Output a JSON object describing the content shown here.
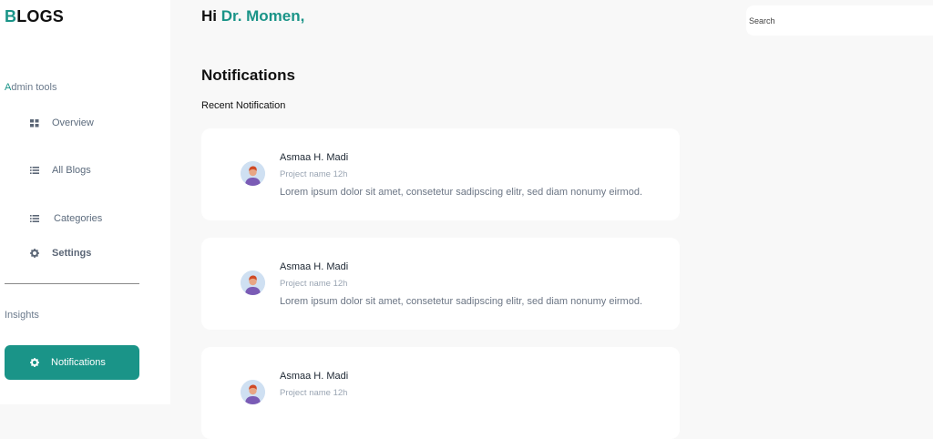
{
  "logo": {
    "first_letter": "B",
    "rest": "LOGS"
  },
  "sidebar": {
    "admin_label_first": "A",
    "admin_label_rest": "dmin tools",
    "items": [
      {
        "label": "Overview",
        "icon": "grid-icon"
      },
      {
        "label": "All Blogs",
        "icon": "list-icon"
      },
      {
        "label": "Categories",
        "icon": "list-icon"
      },
      {
        "label": "Settings",
        "icon": "gear-icon"
      }
    ],
    "insights_label": "Insights",
    "active_item": {
      "label": "Notifications",
      "icon": "gear-icon"
    }
  },
  "header": {
    "greeting": "Hi",
    "user_name": "Dr. Momen,",
    "search_placeholder": "Search"
  },
  "main": {
    "title": "Notifications",
    "subtitle": "Recent Notification",
    "notifications": [
      {
        "author": "Asmaa H. Madi",
        "meta": "Project name 12h",
        "body": "Lorem ipsum dolor sit amet, consetetur sadipscing elitr, sed diam nonumy eirmod."
      },
      {
        "author": "Asmaa H. Madi",
        "meta": "Project name 12h",
        "body": "Lorem ipsum dolor sit amet, consetetur sadipscing elitr, sed diam nonumy eirmod."
      },
      {
        "author": "Asmaa H. Madi",
        "meta": "Project name 12h",
        "body": ""
      }
    ]
  },
  "colors": {
    "accent": "#1a9488",
    "background": "#f8f8f8",
    "card": "#ffffff"
  }
}
